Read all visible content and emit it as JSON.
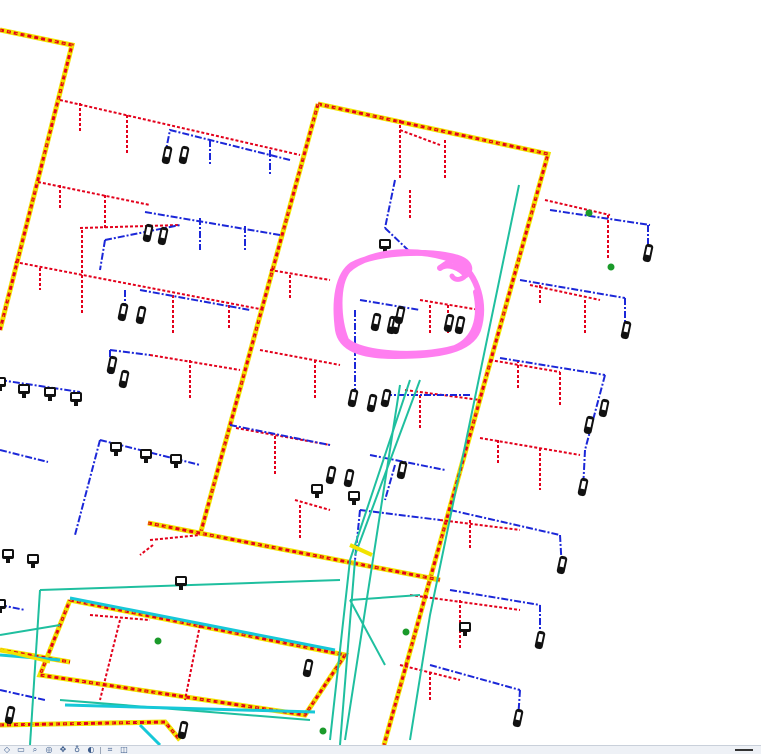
{
  "colors": {
    "background": "#ffffff",
    "duct_red": "#e3001b",
    "duct_blue": "#1b27d8",
    "duct_yellow": "#f2e300",
    "duct_orange": "#f0a000",
    "pipe_teal": "#1fbf9f",
    "pipe_cyan": "#16c8d8",
    "markup_pink": "#ff7ef0",
    "terminal_black": "#111111",
    "valve_green": "#1a9a2a"
  },
  "markup": {
    "type": "freehand-circle",
    "color_name": "markup_pink"
  },
  "statusbar": {
    "icons": [
      "select-icon",
      "window-icon",
      "zoom-icon",
      "orbit-icon",
      "pan-icon",
      "lock-icon",
      "visual-style-icon",
      "crop-icon",
      "hide-icon"
    ]
  }
}
